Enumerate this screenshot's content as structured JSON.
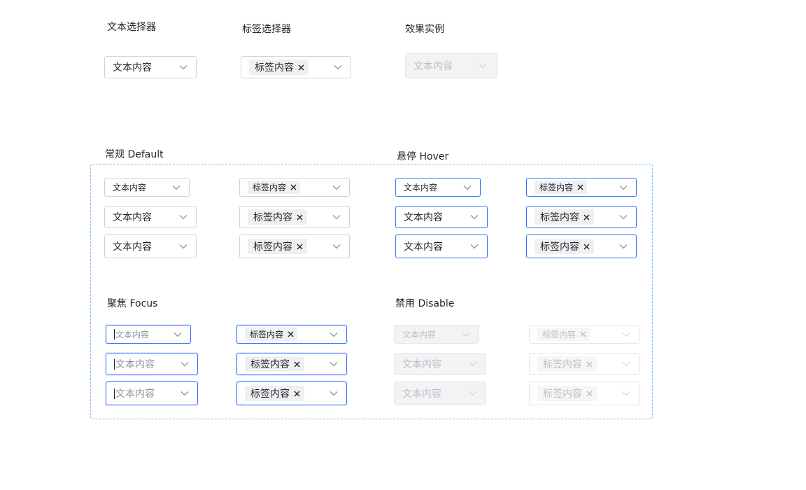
{
  "headings": {
    "text_selector": "文本选择器",
    "tag_selector": "标签选择器",
    "effect_example": "效果实例",
    "default": "常规 Default",
    "hover": "悬停 Hover",
    "focus": "聚焦 Focus",
    "disable": "禁用 Disable"
  },
  "option": {
    "text_value": "文本内容",
    "tag_value": "标签内容"
  },
  "icons": {
    "dropdown": "chevron-down-icon",
    "tag_remove": "close-icon"
  },
  "colors": {
    "focus_border": "#3370ff",
    "default_border": "#d0d3d6",
    "disabled_bg": "#f2f3f5",
    "frame_dashed": "#7cb9f4"
  }
}
